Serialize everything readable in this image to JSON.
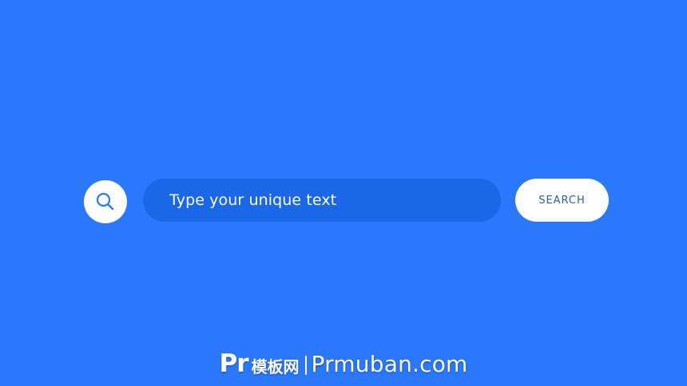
{
  "colors": {
    "background": "#2a78fb",
    "field": "#1a67e8",
    "button": "#ffffff",
    "button_text": "#2a5fa8",
    "icon": "#2a78fb"
  },
  "search": {
    "icon": "search-icon",
    "input_value": "",
    "placeholder": "Type your unique text",
    "button_label": "SEARCH"
  },
  "watermark": {
    "logo": "Pr",
    "cn": "模板网",
    "domain": "Prmuban.com"
  }
}
